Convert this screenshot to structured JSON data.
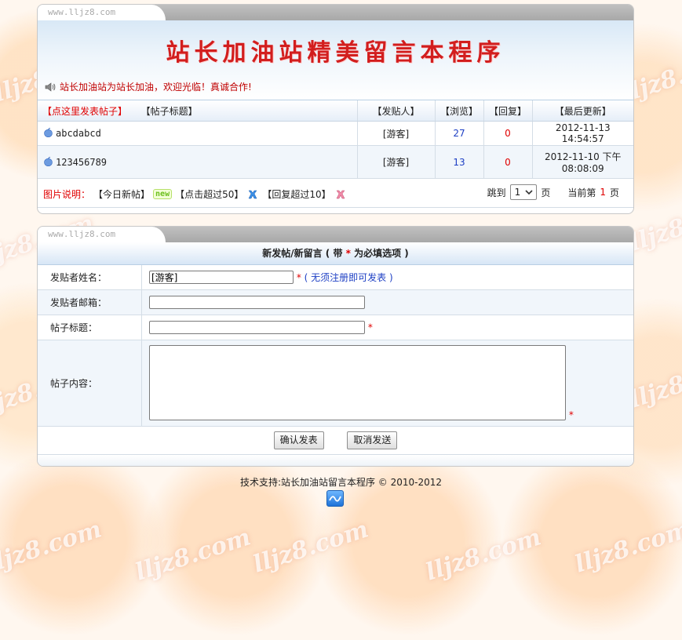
{
  "site": {
    "tab_url": "www.lljz8.com",
    "banner_title": "站长加油站精美留言本程序",
    "notice": "站长加油站为站长加油，欢迎光临！真诚合作!"
  },
  "list": {
    "headers": {
      "post_link": "【点这里发表帖子】",
      "subject": "【帖子标题】",
      "author": "【发贴人】",
      "views": "【浏览】",
      "replies": "【回复】",
      "updated": "【最后更新】"
    },
    "rows": [
      {
        "subject": "abcdabcd",
        "author": "[游客]",
        "views": "27",
        "replies": "0",
        "updated": "2012-11-13 14:54:57"
      },
      {
        "subject": "123456789",
        "author": "[游客]",
        "views": "13",
        "replies": "0",
        "updated": "2012-11-10 下午 08:08:09"
      }
    ],
    "legend": {
      "label": "图片说明：",
      "today": "【今日新帖】",
      "new_badge": "new",
      "clicks": "【点击超过50】",
      "replies": "【回复超过10】"
    },
    "pager": {
      "jump_label": "跳到",
      "page_value": "1",
      "page_unit": "页",
      "current_prefix": "当前第",
      "current_page": "1",
      "current_suffix": "页"
    }
  },
  "form": {
    "heading_prefix": "新发帖/新留言 ( 带",
    "heading_star": "*",
    "heading_suffix": "为必填选项 )",
    "name_label": "发贴者姓名：",
    "name_value": "[游客]",
    "required_mark": "*",
    "name_hint_open": "(",
    "name_hint": "无须注册即可发表",
    "name_hint_close": ")",
    "email_label": "发贴者邮箱：",
    "email_value": "",
    "subject_label": "帖子标题：",
    "subject_value": "",
    "content_label": "帖子内容：",
    "content_value": "",
    "submit_label": "确认发表",
    "cancel_label": "取消发送"
  },
  "footer": {
    "text": "技术支持:站长加油站留言本程序 © 2010-2012"
  },
  "colors": {
    "accent_red": "#e00000",
    "link_blue": "#1d3fc4",
    "header_blue": "#d7e6f6"
  }
}
